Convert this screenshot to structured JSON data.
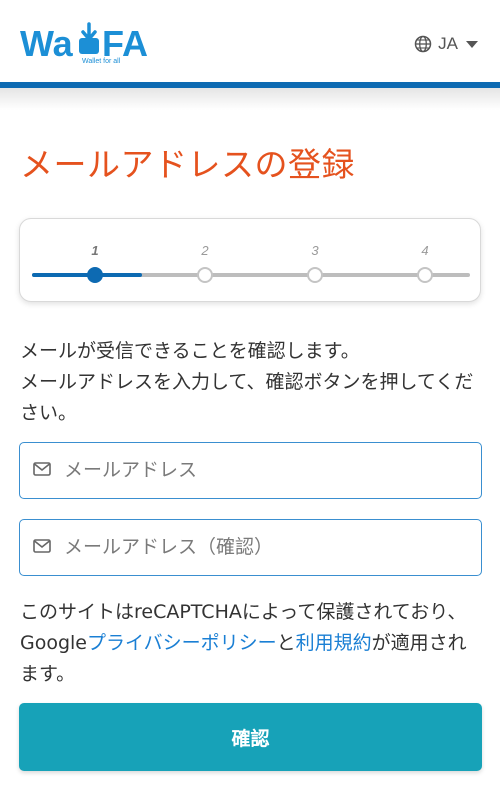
{
  "header": {
    "logo": {
      "main_text": "WaFA",
      "tagline": "Wallet for all",
      "icon": "wallet-download-logo"
    },
    "language": {
      "label": "JA",
      "icon": "globe-icon",
      "caret_icon": "caret-down-icon"
    },
    "accent_color": "#0d6ab2"
  },
  "page": {
    "title": "メールアドレスの登録",
    "title_color": "#e5521e"
  },
  "stepper": {
    "steps": [
      {
        "number": "1",
        "state": "active"
      },
      {
        "number": "2",
        "state": "inactive"
      },
      {
        "number": "3",
        "state": "inactive"
      },
      {
        "number": "4",
        "state": "inactive"
      }
    ],
    "current_step": 1,
    "active_color": "#0d6ab2"
  },
  "instructions": {
    "line1": "メールが受信できることを確認します。",
    "line2": "メールアドレスを入力して、確認ボタンを押してください。"
  },
  "form": {
    "email": {
      "placeholder": "メールアドレス",
      "value": "",
      "icon": "envelope-icon"
    },
    "email_confirm": {
      "placeholder": "メールアドレス（確認）",
      "value": "",
      "icon": "envelope-icon"
    }
  },
  "recaptcha_notice": {
    "prefix": "このサイトはreCAPTCHAによって保護されており、Google",
    "privacy_link": "プライバシーポリシー",
    "conjunction": "と",
    "terms_link": "利用規約",
    "suffix": "が適用されます。",
    "link_color": "#1a7fd4"
  },
  "actions": {
    "confirm_label": "確認",
    "confirm_color": "#17a2b8"
  }
}
